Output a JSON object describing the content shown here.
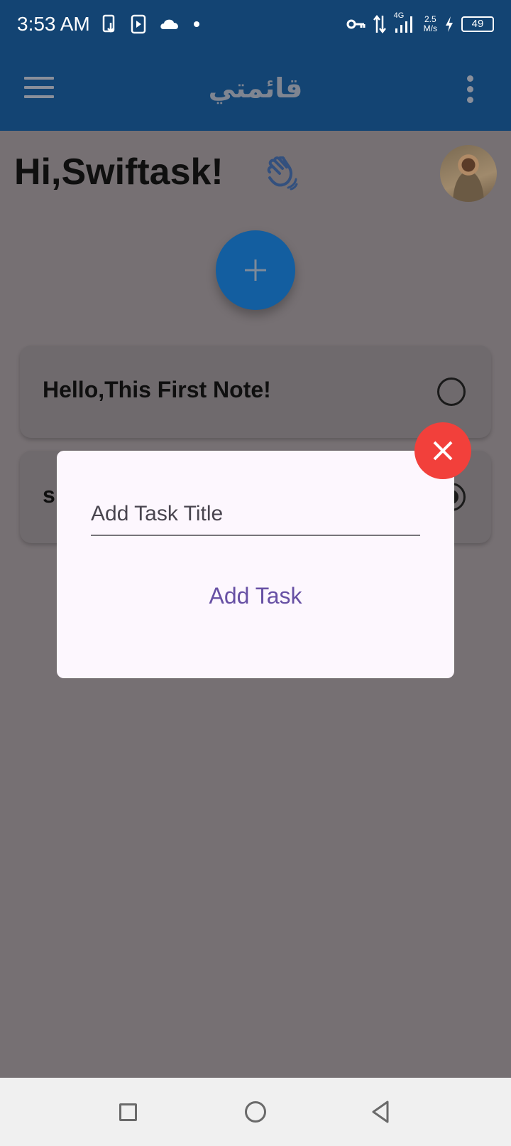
{
  "status_bar": {
    "time": "3:53 AM",
    "network": "4G",
    "speed_value": "2.5",
    "speed_unit": "M/s",
    "battery": "49",
    "icons": [
      "sim-swap-icon",
      "media-icon",
      "cloud-icon",
      "dot-icon",
      "key-icon",
      "data-arrows-icon",
      "signal-icon",
      "charging-icon",
      "battery-icon"
    ]
  },
  "app_bar": {
    "title": "قائمتي",
    "menu_icon": "hamburger-menu-icon",
    "more_icon": "more-vertical-icon"
  },
  "header": {
    "greeting": "Hi,Swiftask!",
    "wave_icon": "waving-hand-icon",
    "avatar": "user-avatar"
  },
  "fab": {
    "icon": "plus-icon"
  },
  "tasks": [
    {
      "title": "Hello,This First Note!",
      "completed": false
    },
    {
      "title": "s",
      "completed": true
    }
  ],
  "dialog": {
    "input_placeholder": "Add Task Title",
    "input_value": "",
    "submit_label": "Add Task",
    "close_icon": "close-icon"
  },
  "colors": {
    "app_bar": "#134473",
    "fab": "#135EA0",
    "scrim": "#767073",
    "dialog_bg": "#FDF7FE",
    "accent": "#6750A4",
    "close_button": "#F2403B"
  },
  "nav_bar": {
    "icons": [
      "recents-square-icon",
      "home-circle-icon",
      "back-triangle-icon"
    ]
  }
}
